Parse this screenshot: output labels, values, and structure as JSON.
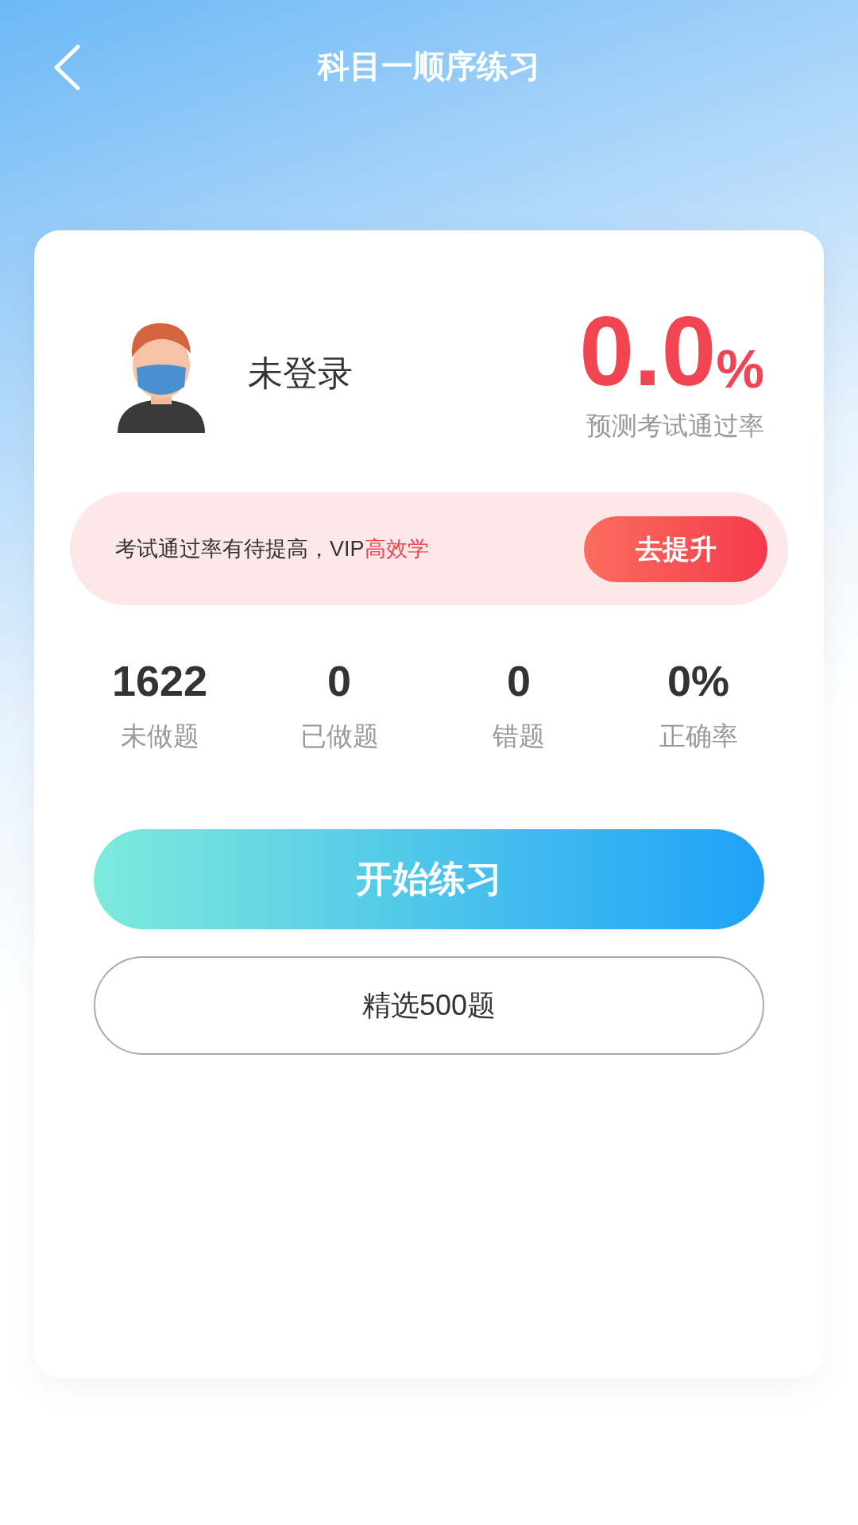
{
  "header": {
    "title": "科目一顺序练习"
  },
  "user": {
    "name": "未登录"
  },
  "pass_rate": {
    "value": "0.0",
    "unit": "%",
    "label": "预测考试通过率"
  },
  "banner": {
    "text": "考试通过率有待提高，VIP",
    "highlight": "高效学",
    "button": "去提升"
  },
  "stats": [
    {
      "value": "1622",
      "label": "未做题"
    },
    {
      "value": "0",
      "label": "已做题"
    },
    {
      "value": "0",
      "label": "错题"
    },
    {
      "value": "0%",
      "label": "正确率"
    }
  ],
  "start_button": "开始练习",
  "secondary_button": "精选500题"
}
